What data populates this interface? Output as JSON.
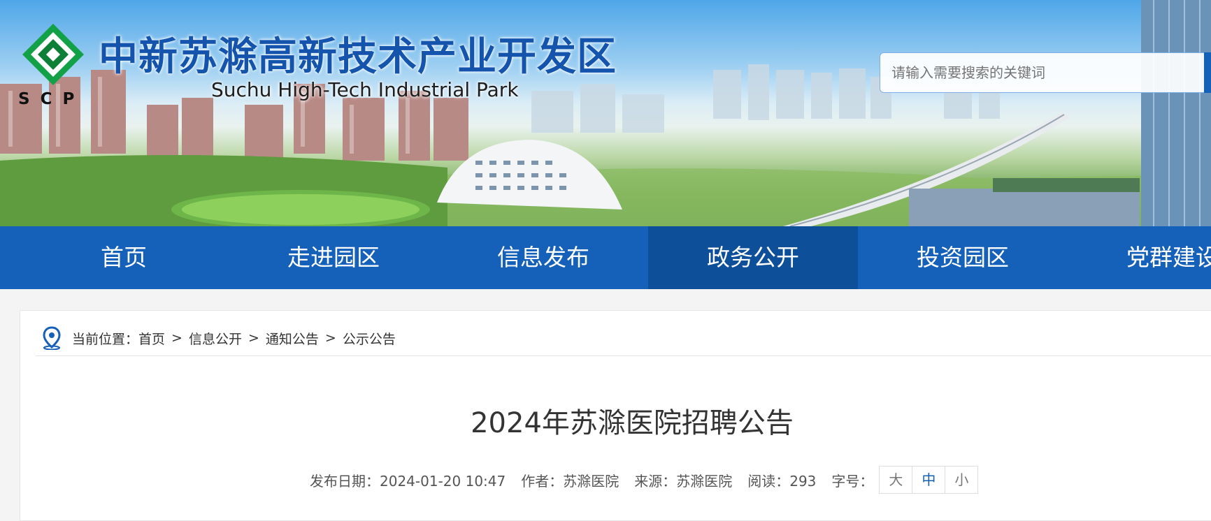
{
  "header": {
    "logo_text": "SCP",
    "title": "中新苏滁高新技术产业开发区",
    "subtitle": "Suchu High-Tech Industrial Park",
    "search_placeholder": "请输入需要搜索的关键词"
  },
  "nav": {
    "items": [
      {
        "label": "首页"
      },
      {
        "label": "走进园区"
      },
      {
        "label": "信息发布"
      },
      {
        "label": "政务公开"
      },
      {
        "label": "投资园区"
      },
      {
        "label": "党群建设"
      }
    ],
    "active": "政务公开"
  },
  "breadcrumb": {
    "prefix": "当前位置：",
    "items": [
      "首页",
      "信息公开",
      "通知公告",
      "公示公告"
    ],
    "separator": ">"
  },
  "article": {
    "title": "2024年苏滁医院招聘公告",
    "meta": {
      "date_label": "发布日期：",
      "date": "2024-01-20 10:47",
      "author_label": "作者：",
      "author": "苏滁医院",
      "source_label": "来源：",
      "source": "苏滁医院",
      "reads_label": "阅读：",
      "reads": "293",
      "fontsize_label": "字号：",
      "fontsize_options": [
        "大",
        "中",
        "小"
      ]
    }
  },
  "colors": {
    "brand_blue": "#1560b8",
    "nav_active": "#0e4f9a",
    "logo_green": "#12a146"
  }
}
